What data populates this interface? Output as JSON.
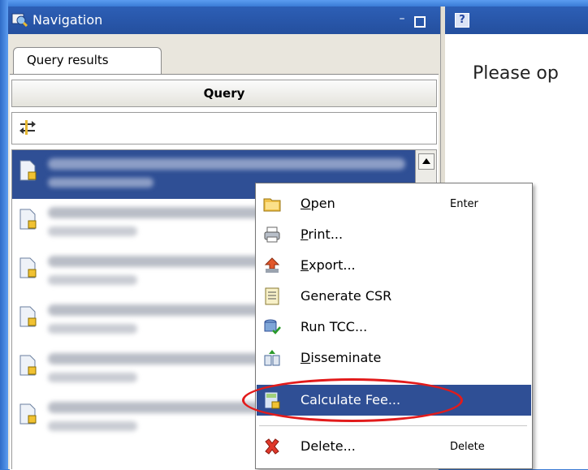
{
  "navigation": {
    "title": "Navigation",
    "tab_label": "Query results",
    "query_button": "Query",
    "rows": [
      {
        "label": "",
        "selected": true
      },
      {
        "label": "",
        "selected": false
      },
      {
        "label": "",
        "selected": false
      },
      {
        "label": "",
        "selected": false
      },
      {
        "label": "",
        "selected": false
      },
      {
        "label": "",
        "selected": false
      }
    ]
  },
  "editor": {
    "message": "Please op"
  },
  "context_menu": {
    "items": [
      {
        "label_u": "O",
        "label_rest": "pen",
        "shortcut": "Enter",
        "icon": "folder-icon"
      },
      {
        "label_u": "P",
        "label_rest": "rint...",
        "shortcut": "",
        "icon": "printer-icon"
      },
      {
        "label_u": "E",
        "label_rest": "xport...",
        "shortcut": "",
        "icon": "export-icon"
      },
      {
        "label_u": "",
        "label_rest": "Generate CSR",
        "shortcut": "",
        "icon": "report-icon"
      },
      {
        "label_u": "",
        "label_rest": "Run TCC...",
        "shortcut": "",
        "icon": "database-check-icon"
      },
      {
        "label_u": "D",
        "label_rest": "isseminate",
        "shortcut": "",
        "icon": "disseminate-icon"
      },
      {
        "label_u": "",
        "label_rest": "Calculate Fee...",
        "shortcut": "",
        "icon": "calculator-icon",
        "highlighted": true
      },
      {
        "label_u": "",
        "label_rest": "Delete...",
        "shortcut": "Delete",
        "icon": "delete-icon"
      }
    ]
  },
  "colors": {
    "titlebar": "#2d5fb6",
    "selection": "#2f4f95",
    "annotation_ring": "#e21b1b"
  }
}
